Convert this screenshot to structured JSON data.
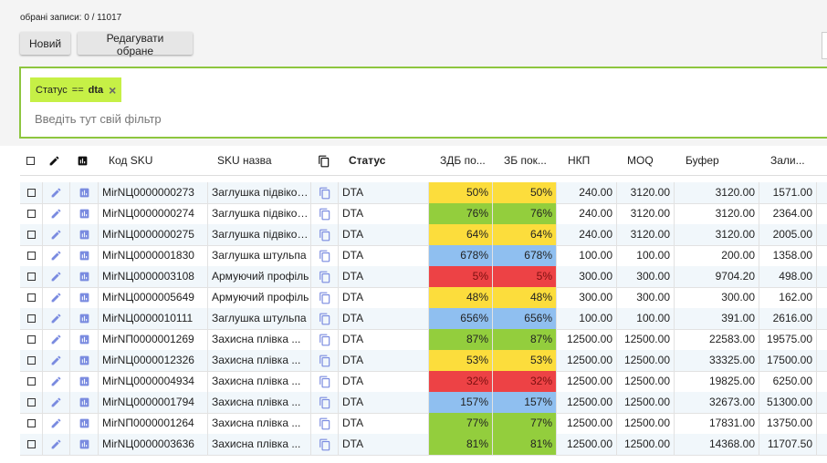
{
  "header": {
    "selected_label": "обрані записи: 0 / 11017",
    "new_button": "Новий",
    "edit_button": "Редагувати обране"
  },
  "filter": {
    "chip_field": "Статус",
    "chip_op": "==",
    "chip_value": "dta",
    "chip_remove": "×",
    "placeholder": "Введіть тут свій фільтр"
  },
  "columns": {
    "sku_code": "Код SKU",
    "sku_name": "SKU назва",
    "status": "Статус",
    "zdb": "ЗДБ по...",
    "zb": "ЗБ пок...",
    "nkp": "НКП",
    "moq": "MOQ",
    "buffer": "Буфер",
    "stock": "Зали..."
  },
  "colors": {
    "yellow": "#fcdd3c",
    "green": "#93ce3d",
    "blue": "#8fbff0",
    "red": "#ed4245",
    "black": "#2b2b2b",
    "icon_blue": "#7a8be0"
  },
  "rows": [
    {
      "sku": "MirNЦ0000000273",
      "name": "Заглушка підвіконня",
      "status": "DTA",
      "zdb": "50%",
      "zb": "50%",
      "zdb_color": "yellow",
      "zb_color": "yellow",
      "nkp": "240.00",
      "moq": "3120.00",
      "buffer": "3120.00",
      "stock": "1571.00"
    },
    {
      "sku": "MirNЦ0000000274",
      "name": "Заглушка підвіконня",
      "status": "DTA",
      "zdb": "76%",
      "zb": "76%",
      "zdb_color": "green",
      "zb_color": "green",
      "nkp": "240.00",
      "moq": "3120.00",
      "buffer": "3120.00",
      "stock": "2364.00"
    },
    {
      "sku": "MirNЦ0000000275",
      "name": "Заглушка підвіконня",
      "status": "DTA",
      "zdb": "64%",
      "zb": "64%",
      "zdb_color": "yellow",
      "zb_color": "yellow",
      "nkp": "240.00",
      "moq": "3120.00",
      "buffer": "3120.00",
      "stock": "2005.00"
    },
    {
      "sku": "MirNЦ0000001830",
      "name": "Заглушка штульпа",
      "status": "DTA",
      "zdb": "678%",
      "zb": "678%",
      "zdb_color": "blue",
      "zb_color": "blue",
      "nkp": "100.00",
      "moq": "100.00",
      "buffer": "200.00",
      "stock": "1358.00"
    },
    {
      "sku": "MirNЦ0000003108",
      "name": "Армуючий профіль",
      "status": "DTA",
      "zdb": "5%",
      "zb": "5%",
      "zdb_color": "red",
      "zb_color": "red",
      "nkp": "300.00",
      "moq": "300.00",
      "buffer": "9704.20",
      "stock": "498.00"
    },
    {
      "sku": "MirNЦ0000005649",
      "name": "Армуючий профіль",
      "status": "DTA",
      "zdb": "48%",
      "zb": "48%",
      "zdb_color": "yellow",
      "zb_color": "yellow",
      "nkp": "300.00",
      "moq": "300.00",
      "buffer": "300.00",
      "stock": "162.00"
    },
    {
      "sku": "MirNЦ0000010111",
      "name": "Заглушка штульпа",
      "status": "DTA",
      "zdb": "656%",
      "zb": "656%",
      "zdb_color": "blue",
      "zb_color": "blue",
      "nkp": "100.00",
      "moq": "100.00",
      "buffer": "391.00",
      "stock": "2616.00"
    },
    {
      "sku": "MirNП0000001269",
      "name": "Захисна плівка ...",
      "status": "DTA",
      "zdb": "87%",
      "zb": "87%",
      "zdb_color": "green",
      "zb_color": "green",
      "nkp": "12500.00",
      "moq": "12500.00",
      "buffer": "22583.00",
      "stock": "19575.00"
    },
    {
      "sku": "MirNЦ0000012326",
      "name": "Захисна плівка ...",
      "status": "DTA",
      "zdb": "53%",
      "zb": "53%",
      "zdb_color": "yellow",
      "zb_color": "yellow",
      "nkp": "12500.00",
      "moq": "12500.00",
      "buffer": "33325.00",
      "stock": "17500.00"
    },
    {
      "sku": "MirNЦ0000004934",
      "name": "Захисна плівка ...",
      "status": "DTA",
      "zdb": "32%",
      "zb": "32%",
      "zdb_color": "red",
      "zb_color": "red",
      "nkp": "12500.00",
      "moq": "12500.00",
      "buffer": "19825.00",
      "stock": "6250.00"
    },
    {
      "sku": "MirNЦ0000001794",
      "name": "Захисна плівка ...",
      "status": "DTA",
      "zdb": "157%",
      "zb": "157%",
      "zdb_color": "blue",
      "zb_color": "blue",
      "nkp": "12500.00",
      "moq": "12500.00",
      "buffer": "32673.00",
      "stock": "51300.00"
    },
    {
      "sku": "MirNП0000001264",
      "name": "Захисна плівка ...",
      "status": "DTA",
      "zdb": "77%",
      "zb": "77%",
      "zdb_color": "green",
      "zb_color": "green",
      "nkp": "12500.00",
      "moq": "12500.00",
      "buffer": "17831.00",
      "stock": "13750.00"
    },
    {
      "sku": "MirNЦ0000003636",
      "name": "Захисна плівка ...",
      "status": "DTA",
      "zdb": "81%",
      "zb": "81%",
      "zdb_color": "green",
      "zb_color": "green",
      "nkp": "12500.00",
      "moq": "12500.00",
      "buffer": "14368.00",
      "stock": "11707.50"
    }
  ]
}
